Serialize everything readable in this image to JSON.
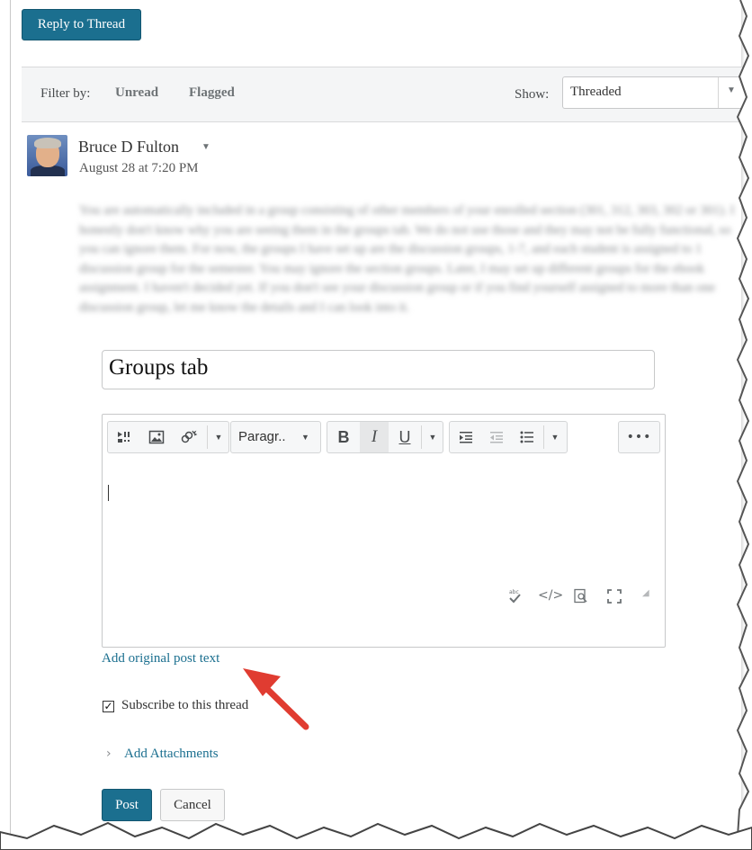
{
  "toolbar": {
    "reply_label": "Reply to Thread"
  },
  "filter": {
    "label": "Filter by:",
    "links": [
      "Unread",
      "Flagged"
    ],
    "show_label": "Show:",
    "show_value": "Threaded"
  },
  "post": {
    "author": "Bruce D Fulton",
    "date": "August 28 at 7:20 PM",
    "body": "You are automatically included in a group consisting of other members of your enrolled section (301, 312, 303, 302 or 301). I honestly don't know why you are seeing them in the groups tab. We do not use those and they may not be fully functional, so you can ignore them. For now, the groups I have set up are the discussion groups, 1-7, and each student is assigned to 1 discussion group for the semester. You may ignore the section groups. Later, I may set up different groups for the ebook assignment. I haven't decided yet. If you don't see your discussion group or if you find yourself assigned to more than one discussion group, let me know the details and I can look into it."
  },
  "reply": {
    "subject": "Groups tab",
    "paragraph_label": "Paragr..",
    "add_original_label": "Add original post text",
    "subscribe_label": "Subscribe to this thread",
    "subscribe_checked": true,
    "attachments_label": "Add Attachments",
    "post_label": "Post",
    "cancel_label": "Cancel"
  },
  "colors": {
    "accent": "#1b6f8f",
    "annotation_arrow": "#e03c31"
  }
}
